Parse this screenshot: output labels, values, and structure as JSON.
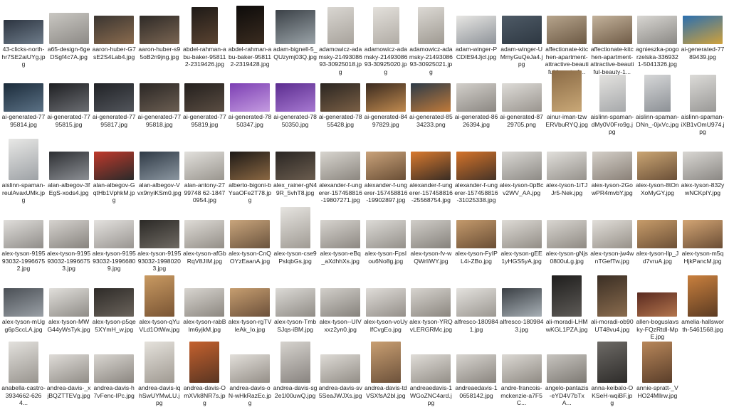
{
  "files": [
    {
      "name": "43-clicks-north-hr7SE2aiUYg.jpg",
      "c1": "#2c3440",
      "c2": "#6e7c8a",
      "h": 34
    },
    {
      "name": "a65-design-6geDSgf4c7A.jpg",
      "c1": "#c9c7c2",
      "c2": "#8d8a86",
      "h": 44
    },
    {
      "name": "aaron-huber-G7sE2S4Lab4.jpg",
      "c1": "#3a3531",
      "c2": "#8a6b4e",
      "h": 40
    },
    {
      "name": "aaron-huber-s95oB2n9jng.jpg",
      "c1": "#2e2a27",
      "c2": "#7a6552",
      "h": 40
    },
    {
      "name": "abdel-rahman-abu-baker-958112-2319426.jpg",
      "c1": "#1e1a17",
      "c2": "#5a4331",
      "h": 52
    },
    {
      "name": "abdel-rahman-abu-baker-958112-2319428.jpg",
      "c1": "#0d0b0a",
      "c2": "#3a2c20",
      "h": 54
    },
    {
      "name": "adam-bignell-5_QUzymj03Q.jpg",
      "c1": "#3b4147",
      "c2": "#9aa3a8",
      "h": 48
    },
    {
      "name": "adamowicz-adamsky-2149308693-30925018.jpg",
      "c1": "#d9d6d1",
      "c2": "#a8a39c",
      "h": 52
    },
    {
      "name": "adamowicz-adamsky-2149308693-30925020.jpg",
      "c1": "#e3e0db",
      "c2": "#b1aca5",
      "h": 52
    },
    {
      "name": "adamowicz-adamsky-2149308693-30925021.jpg",
      "c1": "#dcd9d4",
      "c2": "#9f9a92",
      "h": 52
    },
    {
      "name": "adam-winger-PCDIE94Jjcl.jpg",
      "c1": "#e7e6e3",
      "c2": "#8f949a",
      "h": 40
    },
    {
      "name": "adam-winger-UMmyGuQeJa4.jpg",
      "c1": "#4e5a66",
      "c2": "#2e3842",
      "h": 40
    },
    {
      "name": "affectionate-kitchen-apartment-attractive-beautiful-beauty-1...",
      "c1": "#b6a48c",
      "c2": "#6d5a45",
      "h": 40
    },
    {
      "name": "affectionate-kitchen-apartment-attractive-beautiful-beauty-1...",
      "c1": "#c3b29b",
      "c2": "#705c47",
      "h": 40
    },
    {
      "name": "agnieszka-pogorzelska-3369321-5041326.jpg",
      "c1": "#d8d6d2",
      "c2": "#8b8985",
      "h": 40
    },
    {
      "name": "ai-generated-7789439.jpg",
      "c1": "#2b6fb0",
      "c2": "#d0a13a",
      "h": 40
    },
    {
      "name": "ai-generated-7795814.jpg",
      "c1": "#1b2b3a",
      "c2": "#5b7185",
      "h": 40
    },
    {
      "name": "ai-generated-7795815.jpg",
      "c1": "#1e1f22",
      "c2": "#6b6d72",
      "h": 40
    },
    {
      "name": "ai-generated-7795817.jpg",
      "c1": "#202226",
      "c2": "#52555b",
      "h": 40
    },
    {
      "name": "ai-generated-7795818.jpg",
      "c1": "#2a2624",
      "c2": "#6b5e52",
      "h": 40
    },
    {
      "name": "ai-generated-7795819.jpg",
      "c1": "#231f1d",
      "c2": "#5a4d42",
      "h": 40
    },
    {
      "name": "ai-generated-7850347.jpg",
      "c1": "#7c3fb3",
      "c2": "#c49be0",
      "h": 40
    },
    {
      "name": "ai-generated-7850350.jpg",
      "c1": "#5b2c8f",
      "c2": "#a779d1",
      "h": 40
    },
    {
      "name": "ai-generated-7855428.jpg",
      "c1": "#2a2521",
      "c2": "#7a5f45",
      "h": 40
    },
    {
      "name": "ai-generated-8497829.jpg",
      "c1": "#3a2a1f",
      "c2": "#c08a4f",
      "h": 40
    },
    {
      "name": "ai-generated-8534233.png",
      "c1": "#2c3a48",
      "c2": "#c07a3a",
      "h": 40
    },
    {
      "name": "ai-generated-8626394.jpg",
      "c1": "#d2cfca",
      "c2": "#8c8883",
      "h": 40
    },
    {
      "name": "ai-generated-8729705.png",
      "c1": "#dedcd8",
      "c2": "#9a958f",
      "h": 40
    },
    {
      "name": "ainur-iman-tzwERVbuRYQ.jpg",
      "c1": "#8a6a45",
      "c2": "#c9a877",
      "h": 58
    },
    {
      "name": "aislinn-spaman-dMy0V0Fro9g.jpg",
      "c1": "#e4e3e0",
      "c2": "#a7a9ab",
      "h": 52
    },
    {
      "name": "aislinn-spaman-DNn_-0jxVc.jpg",
      "c1": "#d6d7d8",
      "c2": "#8d9196",
      "h": 52
    },
    {
      "name": "aislinn-spaman-iXB1vOmU974.jpg",
      "c1": "#dcdbd8",
      "c2": "#9a9997",
      "h": 52
    },
    {
      "name": "aislinn-spaman-reulAvaxUMk.jpg",
      "c1": "#e8e8e6",
      "c2": "#9ea2a6",
      "h": 58
    },
    {
      "name": "alan-albegov-3fEgS-xods4.jpg",
      "c1": "#2d2f33",
      "c2": "#8c8f94",
      "h": 40
    },
    {
      "name": "alan-albegov-GqtHb1VphkM.jpg",
      "c1": "#c0392b",
      "c2": "#2a2a2a",
      "h": 40
    },
    {
      "name": "alan-albegov-Vvx9nyiKSm0.jpg",
      "c1": "#2f3a46",
      "c2": "#8b96a0",
      "h": 40
    },
    {
      "name": "alan-antony-2799748 62-18470954.jpg",
      "c1": "#e2e0dc",
      "c2": "#9a968f",
      "h": 40
    },
    {
      "name": "alberto-bigoni-bYsaOFe2T78.jpg",
      "c1": "#1e1a17",
      "c2": "#8a6742",
      "h": 40
    },
    {
      "name": "alex_rainer-gN49R_5vhT8.jpg",
      "c1": "#2a2623",
      "c2": "#6a5c4e",
      "h": 40
    },
    {
      "name": "alexander-f-ungerer-157458816-19807271.jpg",
      "c1": "#d8d5cf",
      "c2": "#8c8780",
      "h": 40
    },
    {
      "name": "alexander-f-ungerer-157458816-19902897.jpg",
      "c1": "#c9a27a",
      "c2": "#6a4f36",
      "h": 40
    },
    {
      "name": "alexander-f-ungerer-157458816-25568754.jpg",
      "c1": "#d97a2f",
      "c2": "#3a2d24",
      "h": 40
    },
    {
      "name": "alexander-f-ungerer-157458816-31025338.jpg",
      "c1": "#d4732a",
      "c2": "#473427",
      "h": 40
    },
    {
      "name": "alex-tyson-0pBcv2WV_AA.jpg",
      "c1": "#dad8d4",
      "c2": "#8e8b86",
      "h": 40
    },
    {
      "name": "alex-tyson-1iTJJr5-Nek.jpg",
      "c1": "#e1dfdb",
      "c2": "#96928c",
      "h": 40
    },
    {
      "name": "alex-tyson-2GowPR4mvbY.jpg",
      "c1": "#d4cfc8",
      "c2": "#8a8178",
      "h": 40
    },
    {
      "name": "alex-tyson-8tOnXoMyGY.jpg",
      "c1": "#caa573",
      "c2": "#6b5038",
      "h": 40
    },
    {
      "name": "alex-tyson-832ywNCKpIY.jpg",
      "c1": "#d9d7d3",
      "c2": "#8b8884",
      "h": 40
    },
    {
      "name": "alex-tyson-919593032-19966752.jpg",
      "c1": "#e0dedb",
      "c2": "#908d89",
      "h": 40
    },
    {
      "name": "alex-tyson-919593032-19966753.jpg",
      "c1": "#d6d3cf",
      "c2": "#87837e",
      "h": 40
    },
    {
      "name": "alex-tyson-919593032-19966809.jpg",
      "c1": "#e4e2df",
      "c2": "#999591",
      "h": 40
    },
    {
      "name": "alex-tyson-919593032-19980203.jpg",
      "c1": "#2b2926",
      "c2": "#6f6a63",
      "h": 40
    },
    {
      "name": "alex-tyson-afGbRqV8JIM.jpg",
      "c1": "#dfdcd7",
      "c2": "#938e87",
      "h": 40
    },
    {
      "name": "alex-tyson-CnQOYzEaanA.jpg",
      "c1": "#c9a57c",
      "c2": "#6a533d",
      "h": 40
    },
    {
      "name": "alex-tyson-cse9PslqbGs.jpg",
      "c1": "#e6e4e0",
      "c2": "#a09b94",
      "h": 58
    },
    {
      "name": "alex-tyson-eBq_aXdhhXs.jpg",
      "c1": "#d7d4cf",
      "c2": "#8d8882",
      "h": 40
    },
    {
      "name": "alex-tyson-FpsIou6No8g.jpg",
      "c1": "#dddbd7",
      "c2": "#94908a",
      "h": 40
    },
    {
      "name": "alex-tyson-fv-wQWrIiWY.jpg",
      "c1": "#d1cec9",
      "c2": "#86827c",
      "h": 40
    },
    {
      "name": "alex-tyson-FyIPL4i-ZBo.jpg",
      "c1": "#c49a6c",
      "c2": "#6a4e35",
      "h": 40
    },
    {
      "name": "alex-tyson-gEE1yHGS5yA.jpg",
      "c1": "#dedbd6",
      "c2": "#928d86",
      "h": 40
    },
    {
      "name": "alex-tyson-gNjs0800uLg.jpg",
      "c1": "#d9d6d1",
      "c2": "#8f8a83",
      "h": 40
    },
    {
      "name": "alex-tyson-jw4wnTGefTw.jpg",
      "c1": "#e2dfda",
      "c2": "#979189",
      "h": 40
    },
    {
      "name": "alex-tyson-llp_Jd7vruA.jpg",
      "c1": "#c79c6a",
      "c2": "#6d5036",
      "h": 40
    },
    {
      "name": "alex-tyson-m5qHjkPancM.jpg",
      "c1": "#d3a574",
      "c2": "#6a4d35",
      "h": 40
    },
    {
      "name": "alex-tyson-mUgg6pSccLA.jpg",
      "c1": "#4a4f55",
      "c2": "#9aa0a6",
      "h": 40
    },
    {
      "name": "alex-tyson-MWG44yWsTyk.jpg",
      "c1": "#e1dfdb",
      "c2": "#8f8c87",
      "h": 40
    },
    {
      "name": "alex-tyson-p5qe5XYmH_w.jpg",
      "c1": "#2e2b28",
      "c2": "#6a635b",
      "h": 40
    },
    {
      "name": "alex-tyson-qYuVLd1OtWw.jpg",
      "c1": "#c99a62",
      "c2": "#7a5534",
      "h": 58
    },
    {
      "name": "alex-tyson-rabBlm6yjkM.jpg",
      "c1": "#d8d5d0",
      "c2": "#8c8780",
      "h": 40
    },
    {
      "name": "alex-tyson-rgTVleAk_Io.jpg",
      "c1": "#c69e70",
      "c2": "#6c503a",
      "h": 40
    },
    {
      "name": "alex-tyson-TmbSJqs-iBM.jpg",
      "c1": "#dcdad6",
      "c2": "#908c86",
      "h": 40
    },
    {
      "name": "alex-tyson--UIVxxz2yn0.jpg",
      "c1": "#d2cfca",
      "c2": "#86827c",
      "h": 40
    },
    {
      "name": "alex-tyson-voUylfCvgEo.jpg",
      "c1": "#e0ddd9",
      "c2": "#948f89",
      "h": 40
    },
    {
      "name": "alex-tyson-YRQvLERGRMc.jpg",
      "c1": "#d7d4cf",
      "c2": "#8b867f",
      "h": 40
    },
    {
      "name": "alfresco-1809841.jpg",
      "c1": "#e4e2de",
      "c2": "#9b9791",
      "h": 40
    },
    {
      "name": "alfresco-1809843.jpg",
      "c1": "#3a3f44",
      "c2": "#a8b0b6",
      "h": 40
    },
    {
      "name": "ali-moradi-LHMwKGL1PZA.jpg",
      "c1": "#1e1d1c",
      "c2": "#5e5b57",
      "h": 58
    },
    {
      "name": "ali-moradi-ob90UT48vu4.jpg",
      "c1": "#3a2e24",
      "c2": "#8a6c4e",
      "h": 58
    },
    {
      "name": "allen-boguslavsky-FQzRtdI-MpE.jpg",
      "c1": "#5a2a20",
      "c2": "#b3754d",
      "h": 34
    },
    {
      "name": "amelia-hallsworth-5461568.jpg",
      "c1": "#c9803e",
      "c2": "#5c3b22",
      "h": 58
    },
    {
      "name": "anabella-castro-3934662-6264...",
      "c1": "#e3e1dd",
      "c2": "#99958f",
      "h": 58
    },
    {
      "name": "andrea-davis-_xjBQZTTEVg.jpg",
      "c1": "#dfdcd8",
      "c2": "#928e88",
      "h": 40
    },
    {
      "name": "andrea-davis-h7vFenc-IPc.jpg",
      "c1": "#d9d6d1",
      "c2": "#8c8781",
      "h": 40
    },
    {
      "name": "andrea-davis-iqhSwUYMwLU.jpg",
      "c1": "#e5e2dc",
      "c2": "#a09a92",
      "h": 58
    },
    {
      "name": "andrea-davis-OmXVk8NR7s.jpg",
      "c1": "#c4612e",
      "c2": "#5a3522",
      "h": 58
    },
    {
      "name": "andrea-davis-oN-wHkRazEc.jpg",
      "c1": "#e2dfda",
      "c2": "#958f88",
      "h": 40
    },
    {
      "name": "andrea-davis-sg2e1l00uwQ.jpg",
      "c1": "#d6d3ce",
      "c2": "#898480",
      "h": 58
    },
    {
      "name": "andrea-davis-sv5SeaJWJXs.jpg",
      "c1": "#dedbd6",
      "c2": "#938e87",
      "h": 40
    },
    {
      "name": "andrea-davis-tdVSXfsA2bI.jpg",
      "c1": "#c99f72",
      "c2": "#6d523b",
      "h": 58
    },
    {
      "name": "andreaedavis-1WGoZNC4ard.jpg",
      "c1": "#e0ddd8",
      "c2": "#948f88",
      "h": 40
    },
    {
      "name": "andreaedavis-10658142.jpg",
      "c1": "#d8d5d0",
      "c2": "#8b8680",
      "h": 40
    },
    {
      "name": "andre-francois-mckenzie-a7F5C...",
      "c1": "#dcd9d4",
      "c2": "#908b84",
      "h": 40
    },
    {
      "name": "angelo-pantazis-eYD4V7bTxA...",
      "c1": "#c7c4bf",
      "c2": "#7e7a74",
      "h": 40
    },
    {
      "name": "anna-keibalo-OKSeH-wqiBF.jpg",
      "c1": "#6d6a66",
      "c2": "#2e2c2a",
      "h": 58
    },
    {
      "name": "annie-spratt-_VHO24Mllrw.jpg",
      "c1": "#b8875a",
      "c2": "#5a3e2a",
      "h": 58
    }
  ]
}
